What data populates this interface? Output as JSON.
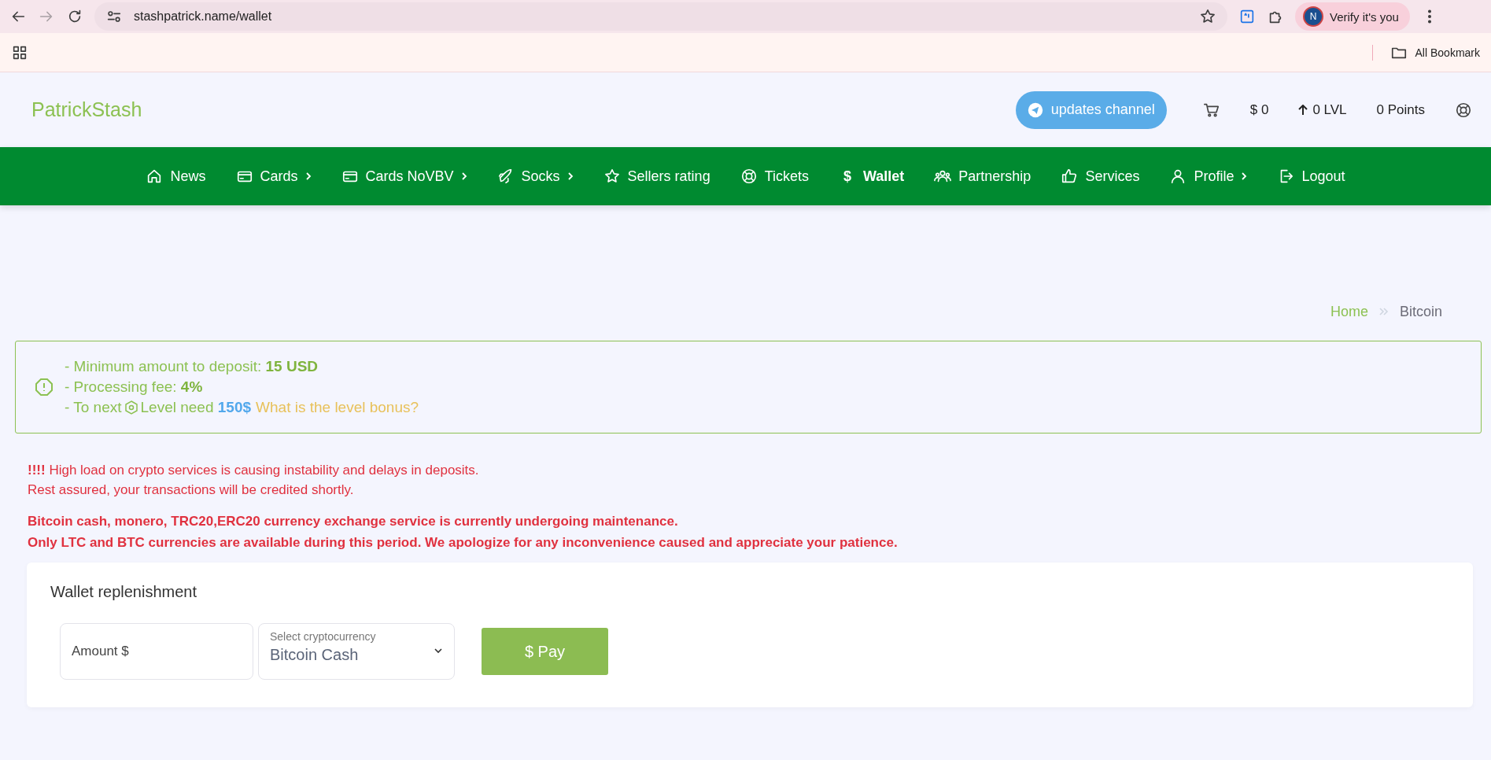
{
  "browser": {
    "url": "stashpatrick.name/wallet",
    "profile_initial": "N",
    "profile_label": "Verify it's you",
    "bookmarks_folder": "All Bookmark"
  },
  "header": {
    "logo": "PatrickStash",
    "updates_button": "updates channel",
    "balance": "$ 0",
    "level": "0 LVL",
    "points": "0 Points"
  },
  "nav": [
    {
      "label": "News",
      "submenu": false,
      "selected": false
    },
    {
      "label": "Cards",
      "submenu": true,
      "selected": false
    },
    {
      "label": "Cards NoVBV",
      "submenu": true,
      "selected": false
    },
    {
      "label": "Socks",
      "submenu": true,
      "selected": false
    },
    {
      "label": "Sellers rating",
      "submenu": false,
      "selected": false
    },
    {
      "label": "Tickets",
      "submenu": false,
      "selected": false
    },
    {
      "label": "Wallet",
      "submenu": false,
      "selected": true,
      "glyph": "$"
    },
    {
      "label": "Partnership",
      "submenu": false,
      "selected": false
    },
    {
      "label": "Services",
      "submenu": false,
      "selected": false
    },
    {
      "label": "Profile",
      "submenu": true,
      "selected": false
    },
    {
      "label": "Logout",
      "submenu": false,
      "selected": false
    }
  ],
  "breadcrumb": [
    "Home",
    "Bitcoin"
  ],
  "info": {
    "lines": [
      "- Minimum amount to deposit: **15 USD**",
      "- Processing fee: **4%**"
    ],
    "level_prefix": "- To next",
    "level_text": "Level need **150$**",
    "level_link": "What is the level bonus?"
  },
  "alerts": [
    "**!!!!** High load on crypto services is causing instability and delays in deposits.",
    "Rest assured, your transactions will be credited shortly."
  ],
  "maintenance": [
    "Bitcoin cash, monero, TRC20,ERC20 currency exchange service is currently undergoing maintenance.",
    "Only LTC and BTC currencies are available during this period. We apologize for any inconvenience caused and appreciate your patience."
  ],
  "card": {
    "title": "Wallet replenishment",
    "amount_placeholder": "Amount $",
    "select_label": "Select cryptocurrency",
    "select_value": "Bitcoin Cash",
    "pay_button": "$ Pay"
  }
}
